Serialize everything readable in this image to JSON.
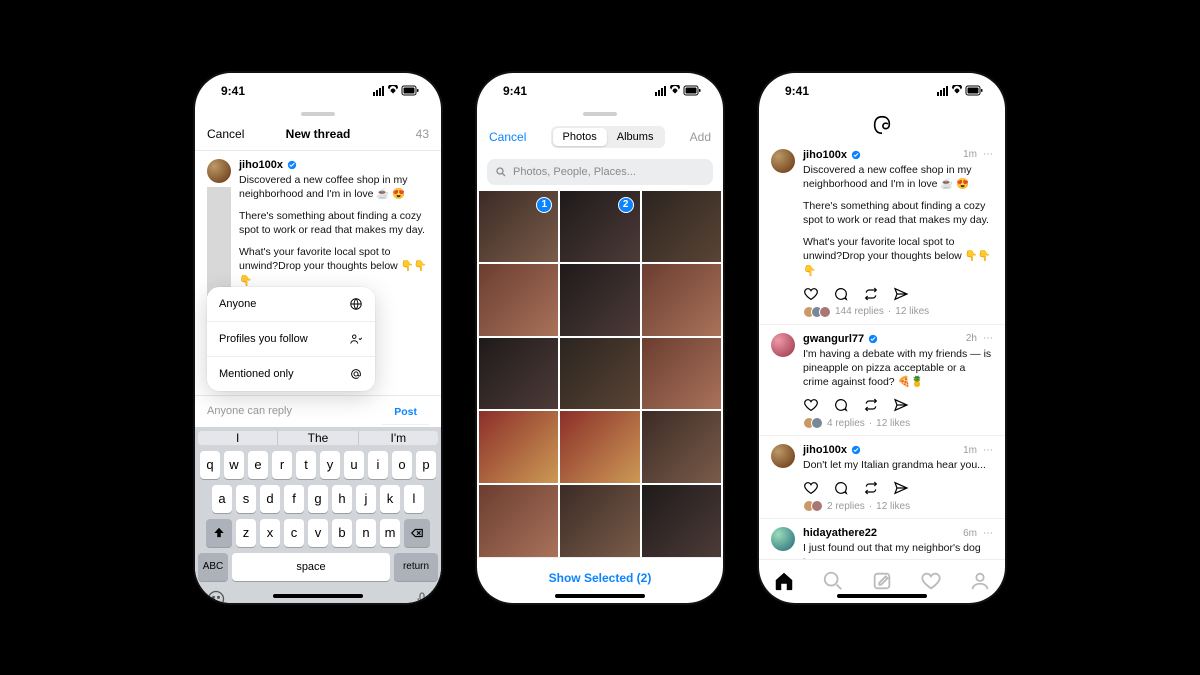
{
  "status": {
    "time": "9:41"
  },
  "phone1": {
    "topbar": {
      "cancel": "Cancel",
      "title": "New thread",
      "count": "43"
    },
    "composer": {
      "username": "jiho100x",
      "body_p1": "Discovered a new coffee shop in my neighborhood and I'm in love ☕ 😍",
      "body_p2": "There's something about finding a cozy spot to work or read that makes my day.",
      "body_p3": "What's your favorite local spot to unwind?Drop your thoughts below 👇👇👇"
    },
    "audience": {
      "anyone": "Anyone",
      "following": "Profiles you follow",
      "mentioned": "Mentioned only"
    },
    "replybar": {
      "hint": "Anyone can reply",
      "post": "Post"
    },
    "keyboard": {
      "predict": [
        "I",
        "The",
        "I'm"
      ],
      "row1": [
        "q",
        "w",
        "e",
        "r",
        "t",
        "y",
        "u",
        "i",
        "o",
        "p"
      ],
      "row2": [
        "a",
        "s",
        "d",
        "f",
        "g",
        "h",
        "j",
        "k",
        "l"
      ],
      "row3": [
        "z",
        "x",
        "c",
        "v",
        "b",
        "n",
        "m"
      ],
      "abc": "ABC",
      "space": "space",
      "return": "return"
    }
  },
  "phone2": {
    "cancel": "Cancel",
    "segPhotos": "Photos",
    "segAlbums": "Albums",
    "add": "Add",
    "search_placeholder": "Photos, People, Places...",
    "selected": {
      "a": "1",
      "b": "2"
    },
    "showSelected": "Show Selected (2)"
  },
  "phone3": {
    "posts": [
      {
        "username": "jiho100x",
        "time": "1m",
        "p1": "Discovered a new coffee shop in my neighborhood and I'm in love ☕ 😍",
        "p2": "There's something about finding a cozy spot to work or read that makes my day.",
        "p3": "What's your favorite local spot to unwind?Drop your thoughts below 👇👇👇",
        "replies": "144 replies",
        "likes": "12 likes"
      },
      {
        "username": "gwangurl77",
        "time": "2h",
        "p1": "I'm having a debate with my friends — is pineapple on pizza acceptable or a crime against food? 🍕🍍",
        "replies": "4 replies",
        "likes": "12 likes"
      },
      {
        "username": "jiho100x",
        "time": "1m",
        "p1": "Don't let my Italian grandma hear you...",
        "replies": "2 replies",
        "likes": "12 likes"
      },
      {
        "username": "hidayathere22",
        "time": "6m",
        "p1": "I just found out that my neighbor's dog has a"
      }
    ]
  }
}
